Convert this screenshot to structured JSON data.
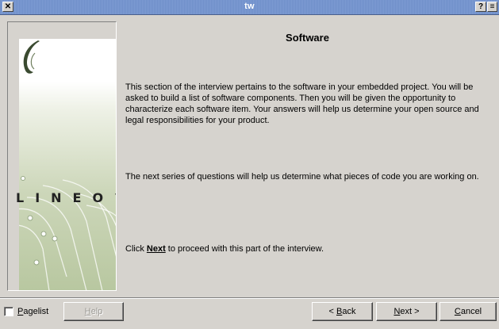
{
  "window": {
    "title": "tw",
    "close_glyph": "✕",
    "help_glyph": "?",
    "menu_glyph": "≡"
  },
  "sidebar": {
    "logo_text": "LINEO",
    "logo_trademark": "™"
  },
  "main": {
    "heading": "Software",
    "paragraph_1": "This section of the interview pertains to the software in your embedded project. You will be asked to build a list of software components. Then you will be given the opportunity to characterize each software item. Your answers will help us determine your open source and legal responsibilities for your product.",
    "paragraph_2": "The next series of questions will help us determine what pieces of code you are working on.",
    "paragraph_3_prefix": "Click ",
    "paragraph_3_bold": "Next",
    "paragraph_3_suffix": " to proceed with this part of the interview."
  },
  "footer": {
    "pagelist_label_first": "P",
    "pagelist_label_rest": "agelist",
    "pagelist_checked": false,
    "help_label_first": "H",
    "help_label_rest": "elp",
    "back_label_prefix": "< ",
    "back_label_first": "B",
    "back_label_rest": "ack",
    "next_label_first": "N",
    "next_label_rest": "ext >",
    "cancel_label_first": "C",
    "cancel_label_rest": "ancel"
  },
  "colors": {
    "titlebar": "#7d9bd3",
    "window_bg": "#d6d3ce",
    "panel_green": "#b8c7a0"
  }
}
